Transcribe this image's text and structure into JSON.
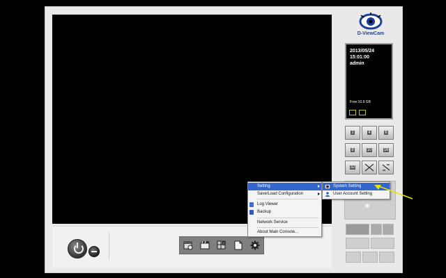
{
  "app": {
    "brand": "D-ViewCam"
  },
  "info_panel": {
    "date": "2013/05/24",
    "time": "15:01:00",
    "user": "admin",
    "free_space": "Free:10.9 GB"
  },
  "layout_buttons": [
    "1",
    "4",
    "6",
    "8",
    "9",
    "10",
    "13",
    "16",
    "32",
    "fullscreen",
    "auto-scan"
  ],
  "toolbar": {
    "icons": [
      "schedule-icon",
      "recording-icon",
      "event-icon",
      "report-icon",
      "gear-icon"
    ]
  },
  "context_menu": {
    "items": [
      {
        "label": "Setting",
        "has_submenu": true,
        "selected": true
      },
      {
        "label": "Save/Load Configuration",
        "has_submenu": true,
        "selected": false
      },
      {
        "label": "Log Viewer",
        "icon": "log-viewer-icon"
      },
      {
        "label": "Backup",
        "icon": "backup-icon"
      },
      {
        "label": "Network Service"
      },
      {
        "label": "About Main Console..."
      }
    ]
  },
  "submenu": {
    "items": [
      {
        "label": "System Setting",
        "icon": "system-setting-icon",
        "selected": true
      },
      {
        "label": "User Account Setting",
        "icon": "user-account-icon",
        "selected": false
      }
    ]
  },
  "colors": {
    "selection": "#3366cc",
    "annotation_arrow": "#e6e600",
    "brand": "#1b3f99"
  }
}
